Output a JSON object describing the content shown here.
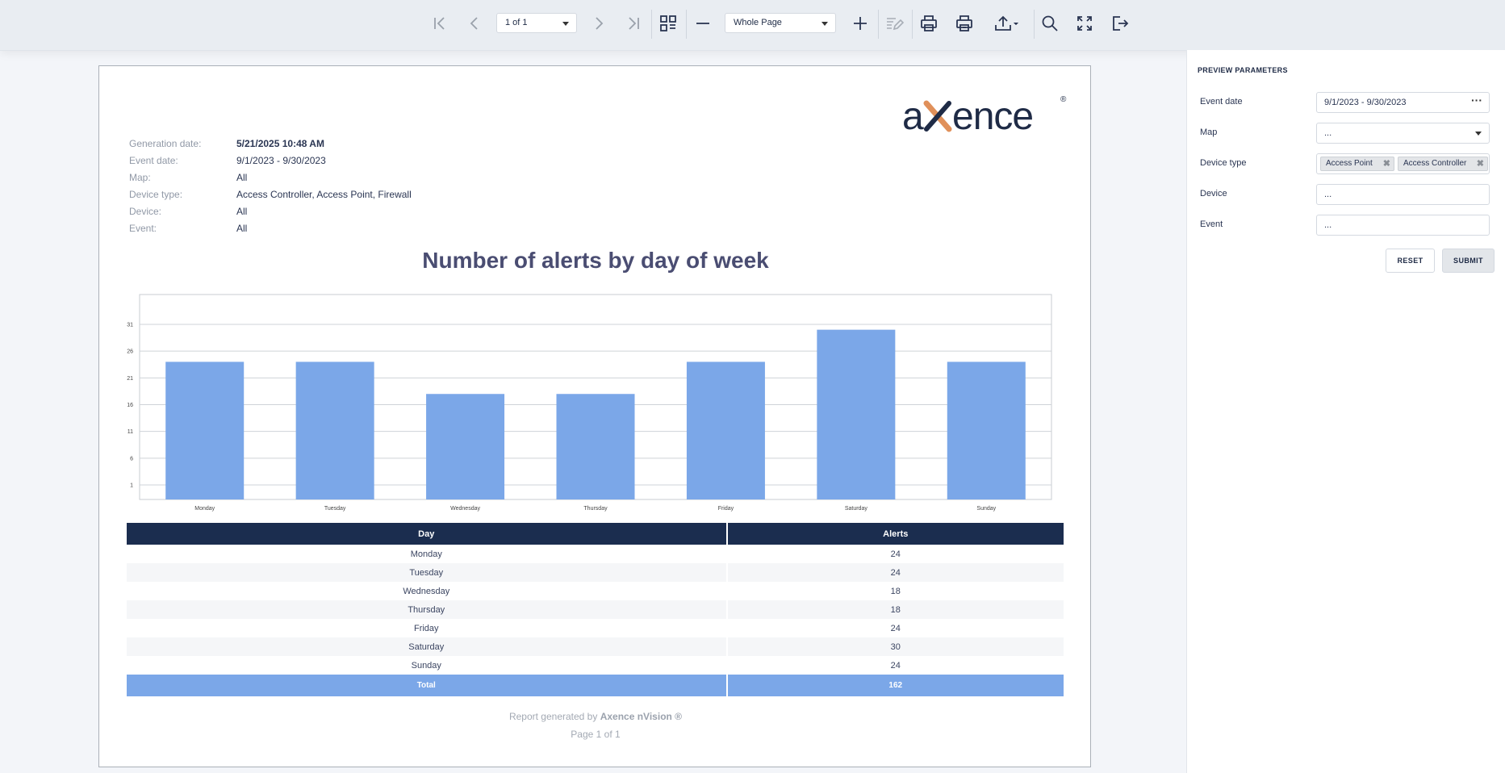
{
  "toolbar": {
    "page_select": "1 of 1",
    "zoom_select": "Whole Page",
    "buttons": [
      "first-page",
      "previous-page",
      "next-page",
      "last-page",
      "multipage",
      "zoom-out",
      "zoom-in",
      "editing-fields",
      "print",
      "print-page",
      "export",
      "search",
      "full-screen",
      "exit"
    ]
  },
  "report": {
    "logo_text": "axence",
    "logo_mark": "®",
    "meta": [
      {
        "label": "Generation date:",
        "value": "5/21/2025 10:48 AM",
        "bold": true
      },
      {
        "label": "Event date:",
        "value": "9/1/2023 - 9/30/2023",
        "bold": false
      },
      {
        "label": "Map:",
        "value": "All",
        "bold": false
      },
      {
        "label": "Device type:",
        "value": "Access Controller, Access Point, Firewall",
        "bold": false
      },
      {
        "label": "Device:",
        "value": "All",
        "bold": false
      },
      {
        "label": "Event:",
        "value": "All",
        "bold": false
      }
    ],
    "title": "Number of alerts by day of week",
    "table": {
      "headers": [
        "Day",
        "Alerts"
      ],
      "rows": [
        [
          "Monday",
          "24"
        ],
        [
          "Tuesday",
          "24"
        ],
        [
          "Wednesday",
          "18"
        ],
        [
          "Thursday",
          "18"
        ],
        [
          "Friday",
          "24"
        ],
        [
          "Saturday",
          "30"
        ],
        [
          "Sunday",
          "24"
        ]
      ],
      "total": [
        "Total",
        "162"
      ]
    },
    "footer_prefix": "Report generated by ",
    "footer_brand": "Axence nVision ®",
    "footer_page": "Page 1 of 1"
  },
  "chart_data": {
    "type": "bar",
    "categories": [
      "Monday",
      "Tuesday",
      "Wednesday",
      "Thursday",
      "Friday",
      "Saturday",
      "Sunday"
    ],
    "values": [
      24,
      24,
      18,
      18,
      24,
      30,
      24
    ],
    "yticks": [
      1,
      6,
      11,
      16,
      21,
      26,
      31
    ],
    "ylim": [
      0,
      32
    ],
    "grid": true,
    "bar_color": "#7ba7e8",
    "title": "",
    "xlabel": "",
    "ylabel": ""
  },
  "params": {
    "title": "PREVIEW PARAMETERS",
    "event_date": {
      "label": "Event date",
      "value": "9/1/2023 - 9/30/2023"
    },
    "map": {
      "label": "Map",
      "value": "..."
    },
    "device_type": {
      "label": "Device type",
      "tags": [
        "Access Point",
        "Access Controller"
      ]
    },
    "device": {
      "label": "Device",
      "value": "..."
    },
    "event": {
      "label": "Event",
      "value": "..."
    },
    "reset_label": "RESET",
    "submit_label": "SUBMIT"
  },
  "colors": {
    "header_navy": "#1b2d4f",
    "accent_blue": "#7ba7e8",
    "logo_orange": "#e0905a"
  }
}
